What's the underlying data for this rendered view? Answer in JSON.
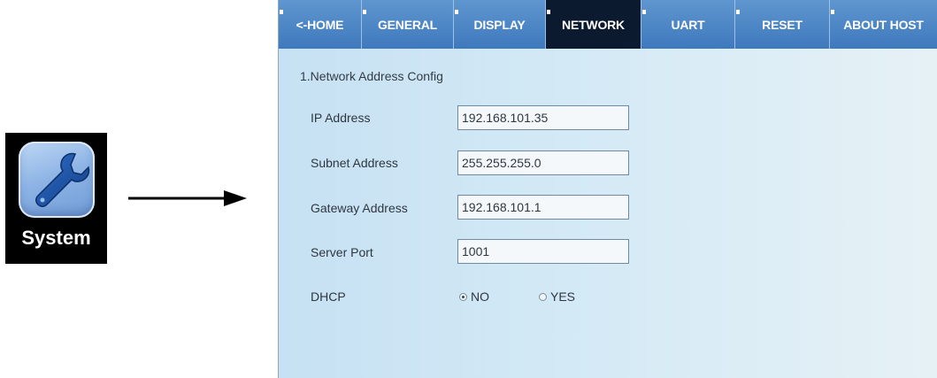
{
  "app_icon": {
    "label": "System",
    "icon": "wrench-icon"
  },
  "tabs": [
    {
      "label": "<-HOME",
      "active": false
    },
    {
      "label": "GENERAL",
      "active": false
    },
    {
      "label": "DISPLAY",
      "active": false
    },
    {
      "label": "NETWORK",
      "active": true
    },
    {
      "label": "UART",
      "active": false
    },
    {
      "label": "RESET",
      "active": false
    },
    {
      "label": "ABOUT HOST",
      "active": false
    }
  ],
  "section": {
    "title": "1.Network Address Config"
  },
  "fields": {
    "ip": {
      "label": "IP Address",
      "value": "192.168.101.35"
    },
    "subnet": {
      "label": "Subnet Address",
      "value": "255.255.255.0"
    },
    "gateway": {
      "label": "Gateway Address",
      "value": "192.168.101.1"
    },
    "port": {
      "label": "Server Port",
      "value": "1001"
    }
  },
  "dhcp": {
    "label": "DHCP",
    "options": [
      {
        "label": "NO",
        "selected": true
      },
      {
        "label": "YES",
        "selected": false
      }
    ]
  },
  "colors": {
    "tab_bar": "#4a84c6",
    "tab_active": "#0b1a2e",
    "screen_bg": "#d0e6f4"
  }
}
